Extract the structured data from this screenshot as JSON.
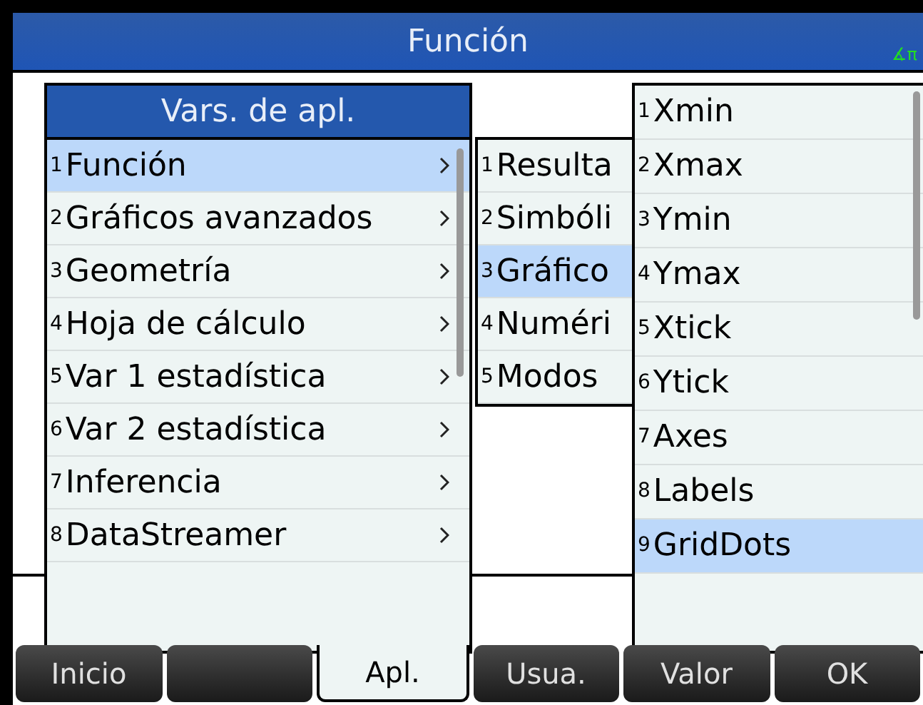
{
  "title_bar": {
    "title": "Función",
    "angle_indicator": "∡π"
  },
  "apps_menu": {
    "title": "Vars. de apl.",
    "items": [
      {
        "number": "1",
        "label": "Función",
        "submenu": true,
        "selected": true
      },
      {
        "number": "2",
        "label": "Gráficos avanzados",
        "submenu": true,
        "selected": false
      },
      {
        "number": "3",
        "label": "Geometría",
        "submenu": true,
        "selected": false
      },
      {
        "number": "4",
        "label": "Hoja de cálculo",
        "submenu": true,
        "selected": false
      },
      {
        "number": "5",
        "label": "Var 1 estadística",
        "submenu": true,
        "selected": false
      },
      {
        "number": "6",
        "label": "Var 2 estadística",
        "submenu": true,
        "selected": false
      },
      {
        "number": "7",
        "label": "Inferencia",
        "submenu": true,
        "selected": false
      },
      {
        "number": "8",
        "label": "DataStreamer",
        "submenu": true,
        "selected": false
      }
    ]
  },
  "category_menu": {
    "items": [
      {
        "number": "1",
        "label": "Resulta",
        "selected": false
      },
      {
        "number": "2",
        "label": "Simbóli",
        "selected": false
      },
      {
        "number": "3",
        "label": "Gráfico",
        "selected": true
      },
      {
        "number": "4",
        "label": "Numéri",
        "selected": false
      },
      {
        "number": "5",
        "label": "Modos",
        "selected": false
      }
    ]
  },
  "variables_menu": {
    "items": [
      {
        "number": "1",
        "label": "Xmin",
        "selected": false
      },
      {
        "number": "2",
        "label": "Xmax",
        "selected": false
      },
      {
        "number": "3",
        "label": "Ymin",
        "selected": false
      },
      {
        "number": "4",
        "label": "Ymax",
        "selected": false
      },
      {
        "number": "5",
        "label": "Xtick",
        "selected": false
      },
      {
        "number": "6",
        "label": "Ytick",
        "selected": false
      },
      {
        "number": "7",
        "label": "Axes",
        "selected": false
      },
      {
        "number": "8",
        "label": "Labels",
        "selected": false
      },
      {
        "number": "9",
        "label": "GridDots",
        "selected": true
      }
    ]
  },
  "softkeys": [
    {
      "label": "Inicio",
      "selected": false
    },
    {
      "selected": false
    },
    {
      "label": "Apl.",
      "selected": true
    },
    {
      "label": "Usua.",
      "selected": false
    },
    {
      "label": "Valor",
      "selected": false
    },
    {
      "label": "OK",
      "selected": false
    }
  ]
}
